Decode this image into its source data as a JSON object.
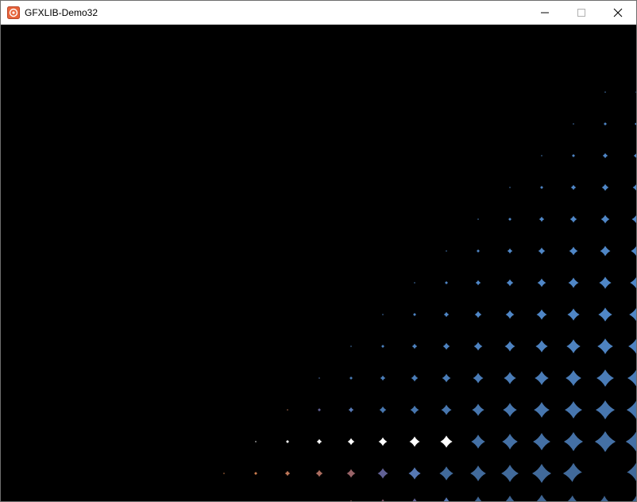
{
  "window": {
    "title": "GFXLIB-Demo32",
    "icon": "app-icon",
    "controls": [
      "minimize-icon",
      "maximize-icon",
      "close-icon"
    ]
  },
  "canvas": {
    "background": "#000000",
    "pattern": "diamond-dot-grid",
    "colors": {
      "blue": "#4f86c6",
      "purple": "#6b4c7a",
      "orange": "#d9844c",
      "white": "#ffffff",
      "dark_blue": "#3b5f8a"
    }
  }
}
